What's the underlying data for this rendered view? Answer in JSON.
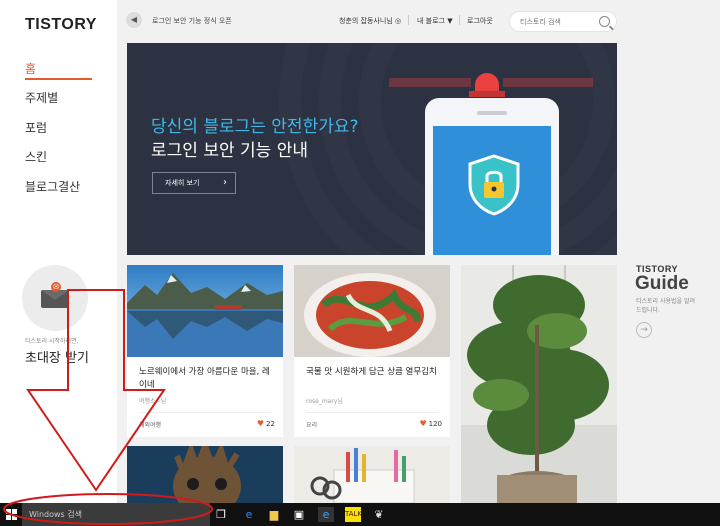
{
  "sidebar": {
    "logo": "TISTORY",
    "nav": [
      {
        "label": "홈",
        "active": true
      },
      {
        "label": "주제별"
      },
      {
        "label": "포럼"
      },
      {
        "label": "스킨"
      },
      {
        "label": "블로그결산"
      }
    ],
    "invite": {
      "subtitle": "티스토리 시작하려면,",
      "title": "초대장 받기",
      "icon": "envelope-icon"
    }
  },
  "header": {
    "notice": "로그인 보안 기능 정식 오픈",
    "user_link": "청춘의 잡동사니님 ◎",
    "my_blog": "내 블로그 ▼",
    "logout": "로그아웃",
    "search_placeholder": "티스토리 검색"
  },
  "banner": {
    "question": "당신의 블로그는 안전한가요?",
    "title": "로그인 보안 기능 안내",
    "button": "자세히 보기",
    "colors": {
      "bg": "#2c3242",
      "accent": "#3fb8e9",
      "siren": "#e94140"
    }
  },
  "cards": [
    {
      "title": "노르웨이에서 가장 아름다운 마을, 레이네",
      "author": "여행소~님",
      "category": "해외여행",
      "likes": "22"
    },
    {
      "title": "국물 맛 시원하게 담근 상큼 열무김치",
      "author": "rose_mary님",
      "category": "요리",
      "likes": "120"
    },
    {
      "title": "",
      "author": "",
      "category": "",
      "likes": ""
    }
  ],
  "guide": {
    "top": "TISTORY",
    "big": "Guide",
    "sub": "티스토리 사용법을 알려드립니다."
  },
  "taskbar": {
    "search_placeholder": "Windows 검색",
    "icons": [
      "task-view-icon",
      "edge-icon",
      "file-explorer-icon",
      "store-icon",
      "internet-explorer-icon",
      "kakaotalk-icon",
      "app-icon"
    ]
  },
  "accent_color": "#e75a2c"
}
